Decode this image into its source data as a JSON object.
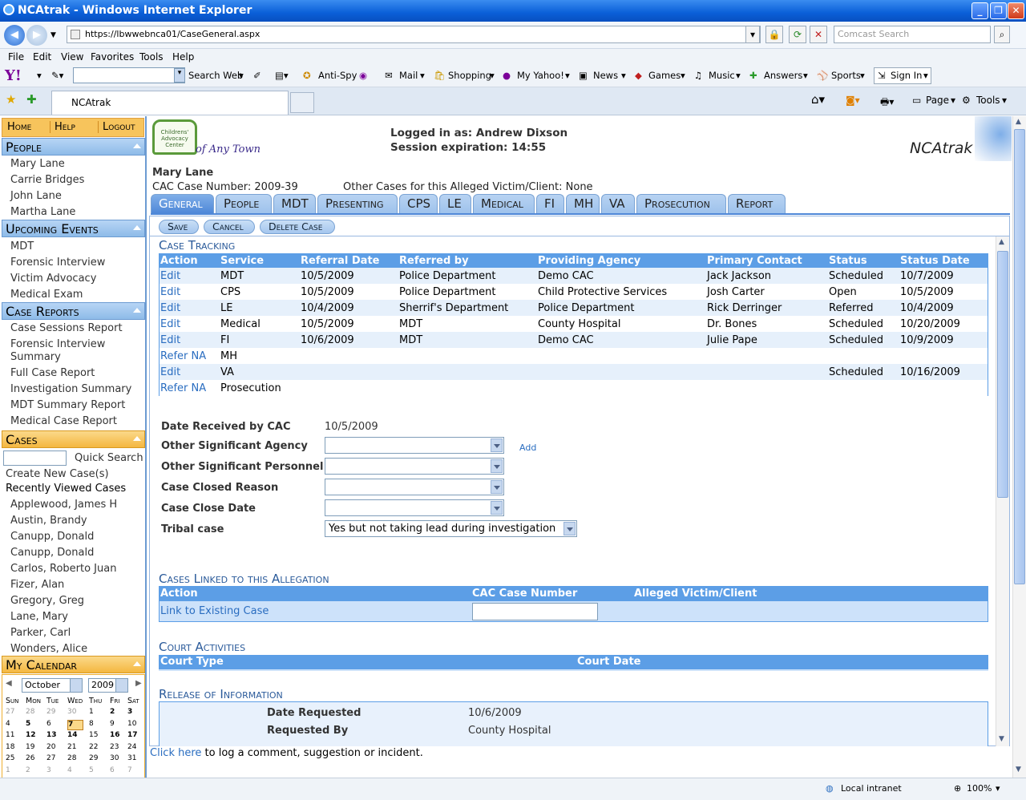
{
  "window": {
    "title": "NCAtrak - Windows Internet Explorer",
    "url": "https://lbwwebnca01/CaseGeneral.aspx",
    "search_placeholder": "Comcast Search",
    "tab_title": "NCAtrak"
  },
  "menu": [
    "File",
    "Edit",
    "View",
    "Favorites",
    "Tools",
    "Help"
  ],
  "ytoolbar": {
    "search_label": "Search Web",
    "items": [
      "Anti-Spy",
      "Mail",
      "Shopping",
      "My Yahoo!",
      "News",
      "Games",
      "Music",
      "Answers",
      "Sports",
      "Sign In"
    ]
  },
  "ietools": {
    "page": "Page",
    "tools": "Tools"
  },
  "sidebar": {
    "top": [
      "Home",
      "Help",
      "Logout"
    ],
    "people_title": "People",
    "people": [
      "Mary Lane",
      "Carrie Bridges",
      "John Lane",
      "Martha Lane"
    ],
    "events_title": "Upcoming Events",
    "events": [
      "MDT",
      "Forensic Interview",
      "Victim Advocacy",
      "Medical Exam"
    ],
    "reports_title": "Case Reports",
    "reports": [
      "Case Sessions Report",
      "Forensic Interview",
      "Summary",
      "Full Case Report",
      "Investigation Summary",
      "MDT Summary Report",
      "Medical Case Report"
    ],
    "cases_title": "Cases",
    "quick_search": "Quick Search",
    "create_new": "Create New Case(s)",
    "recently_viewed": "Recently Viewed Cases",
    "recent": [
      "Applewood, James H",
      "Austin, Brandy",
      "Canupp, Donald",
      "Canupp, Donald",
      "Carlos, Roberto Juan",
      "Fizer, Alan",
      "Gregory, Greg",
      "Lane, Mary",
      "Parker, Carl",
      "Wonders, Alice"
    ],
    "calendar_title": "My Calendar",
    "month": "October",
    "year": "2009",
    "weekdays": [
      "Sun",
      "Mon",
      "Tue",
      "Wed",
      "Thu",
      "Fri",
      "Sat"
    ],
    "days": [
      "27",
      "28",
      "29",
      "30",
      "1",
      "2",
      "3",
      "4",
      "5",
      "6",
      "7",
      "8",
      "9",
      "10",
      "11",
      "12",
      "13",
      "14",
      "15",
      "16",
      "17",
      "18",
      "19",
      "20",
      "21",
      "22",
      "23",
      "24",
      "25",
      "26",
      "27",
      "28",
      "29",
      "30",
      "31",
      "1",
      "2",
      "3",
      "4",
      "5",
      "6",
      "7"
    ]
  },
  "header": {
    "logo_top": "Childrens' Advocacy Center",
    "logo_text": "of Any Town",
    "logged_in": "Logged in as: Andrew Dixson",
    "session": "Session expiration: 14:55",
    "brand": "NCAtrak",
    "client": "Mary Lane",
    "case_number": "CAC Case Number: 2009-39",
    "other_cases": "Other Cases for this Alleged Victim/Client: None"
  },
  "tabs": [
    "General",
    "People",
    "MDT",
    "Presenting",
    "CPS",
    "LE",
    "Medical",
    "FI",
    "MH",
    "VA",
    "Prosecution",
    "Report"
  ],
  "buttons": [
    "Save",
    "Cancel",
    "Delete Case"
  ],
  "tracking": {
    "title": "Case Tracking",
    "columns": [
      "Action",
      "Service",
      "Referral Date",
      "Referred by",
      "Providing Agency",
      "Primary Contact",
      "Status",
      "Status Date"
    ],
    "rows": [
      [
        "Edit",
        "MDT",
        "10/5/2009",
        "Police Department",
        "Demo CAC",
        "Jack Jackson",
        "Scheduled",
        "10/7/2009"
      ],
      [
        "Edit",
        "CPS",
        "10/5/2009",
        "Police Department",
        "Child Protective Services",
        "Josh Carter",
        "Open",
        "10/5/2009"
      ],
      [
        "Edit",
        "LE",
        "10/4/2009",
        "Sherrif's Department",
        "Police Department",
        "Rick Derringer",
        "Referred",
        "10/4/2009"
      ],
      [
        "Edit",
        "Medical",
        "10/5/2009",
        "MDT",
        "County Hospital",
        "Dr. Bones",
        "Scheduled",
        "10/20/2009"
      ],
      [
        "Edit",
        "FI",
        "10/6/2009",
        "MDT",
        "Demo CAC",
        "Julie Pape",
        "Scheduled",
        "10/9/2009"
      ],
      [
        "Refer NA",
        "MH",
        "",
        "",
        "",
        "",
        "",
        ""
      ],
      [
        "Edit",
        "VA",
        "",
        "",
        "",
        "",
        "Scheduled",
        "10/16/2009"
      ],
      [
        "Refer NA",
        "Prosecution",
        "",
        "",
        "",
        "",
        "",
        ""
      ]
    ]
  },
  "form": {
    "date_received_label": "Date Received by CAC",
    "date_received": "10/5/2009",
    "agency_label": "Other Significant Agency",
    "add": "Add",
    "personnel_label": "Other Significant Personnel",
    "closed_reason_label": "Case Closed Reason",
    "close_date_label": "Case Close Date",
    "tribal_label": "Tribal case",
    "tribal_value": "Yes but not taking lead during investigation"
  },
  "linked": {
    "title": "Cases Linked to this Allegation",
    "columns": [
      "Action",
      "CAC Case Number",
      "Alleged Victim/Client"
    ],
    "link": "Link to Existing Case"
  },
  "court": {
    "title": "Court Activities",
    "columns": [
      "Court Type",
      "Court Date"
    ]
  },
  "release": {
    "title": "Release of Information",
    "date_label": "Date Requested",
    "date": "10/6/2009",
    "by_label": "Requested By",
    "by": "County Hospital"
  },
  "footer": {
    "link": "Click here",
    "text": " to log a comment, suggestion or incident."
  },
  "status": {
    "zone": "Local intranet",
    "zoom": "100%"
  }
}
